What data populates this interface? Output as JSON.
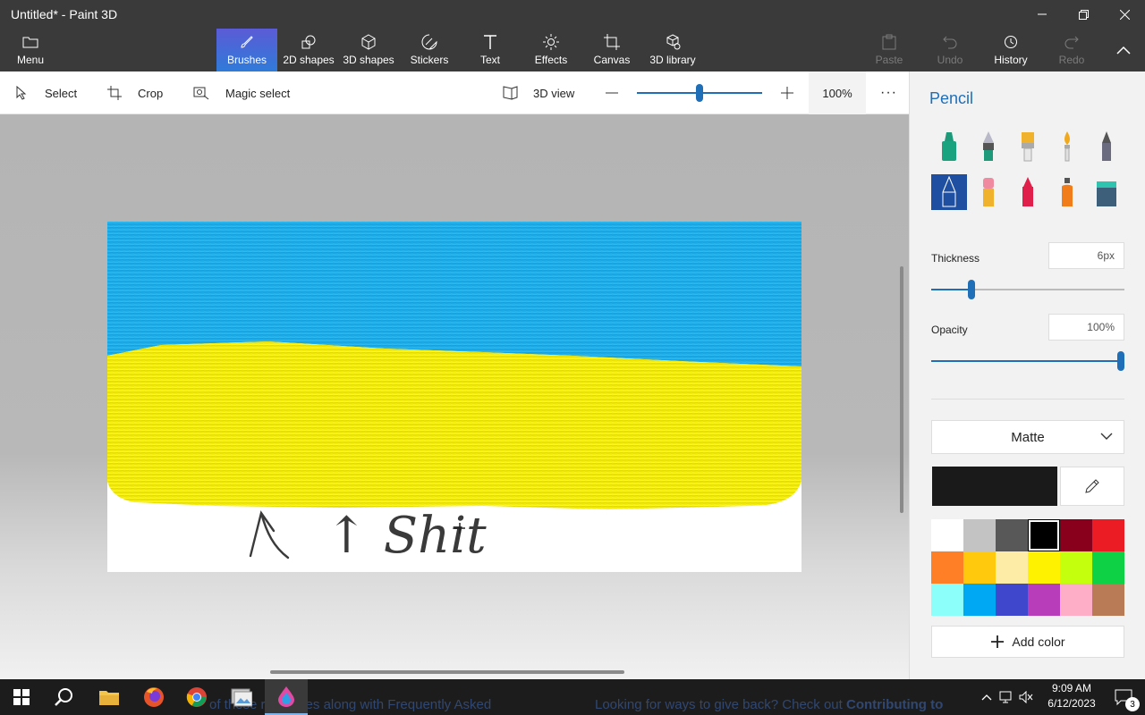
{
  "window": {
    "title": "Untitled* - Paint 3D"
  },
  "ribbon": {
    "menu": "Menu",
    "tabs": [
      {
        "label": "Brushes",
        "icon": "brush-icon"
      },
      {
        "label": "2D shapes",
        "icon": "2d-shapes-icon"
      },
      {
        "label": "3D shapes",
        "icon": "3d-shapes-icon"
      },
      {
        "label": "Stickers",
        "icon": "stickers-icon"
      },
      {
        "label": "Text",
        "icon": "text-icon"
      },
      {
        "label": "Effects",
        "icon": "effects-icon"
      },
      {
        "label": "Canvas",
        "icon": "canvas-icon"
      },
      {
        "label": "3D library",
        "icon": "3d-library-icon"
      }
    ],
    "paste": "Paste",
    "undo": "Undo",
    "history": "History",
    "redo": "Redo"
  },
  "toolbar": {
    "select": "Select",
    "crop": "Crop",
    "magic_select": "Magic select",
    "view_3d": "3D view",
    "zoom": "100%",
    "zoom_level": 0.5,
    "more": "···"
  },
  "canvas": {
    "handwriting": "↑ Shit"
  },
  "panel": {
    "title": "Pencil",
    "thickness_label": "Thickness",
    "thickness_value": "6px",
    "thickness_level": 0.21,
    "opacity_label": "Opacity",
    "opacity_value": "100%",
    "opacity_level": 1.0,
    "finish": "Matte",
    "add_color": "Add color",
    "current_color": "#1a1a1a",
    "palette": [
      "#ffffff",
      "#c3c3c3",
      "#585858",
      "#000000",
      "#88001b",
      "#ec1c24",
      "#ff7f27",
      "#ffc90e",
      "#fdeca6",
      "#fff200",
      "#c4ff0e",
      "#0ed145",
      "#8cfffb",
      "#00a8f3",
      "#3f48cc",
      "#b83dba",
      "#ffaec8",
      "#b97a56"
    ]
  },
  "taskbar": {
    "ghost_text_1": "of these resources along with Frequently Asked",
    "ghost_text_2a": "Looking for ways to give back? Check out ",
    "ghost_text_2b": "Contributing to",
    "time": "9:09 AM",
    "date": "6/12/2023",
    "notification_count": "3"
  }
}
